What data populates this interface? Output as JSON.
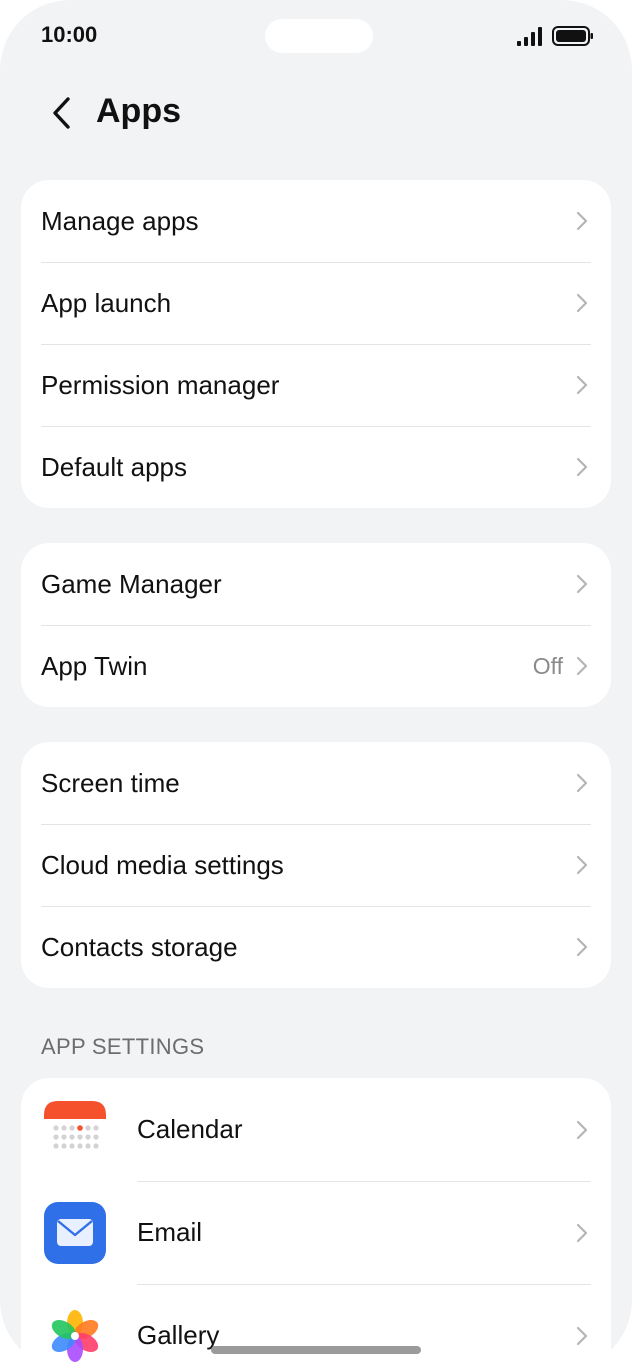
{
  "status_bar": {
    "time": "10:00",
    "icons": [
      "signal-icon",
      "battery-icon"
    ]
  },
  "header": {
    "title": "Apps",
    "back_icon": "chevron-left-icon"
  },
  "groups": [
    {
      "items": [
        {
          "label": "Manage apps"
        },
        {
          "label": "App launch"
        },
        {
          "label": "Permission manager"
        },
        {
          "label": "Default apps"
        }
      ]
    },
    {
      "items": [
        {
          "label": "Game Manager"
        },
        {
          "label": "App Twin",
          "value": "Off"
        }
      ]
    },
    {
      "items": [
        {
          "label": "Screen time"
        },
        {
          "label": "Cloud media settings"
        },
        {
          "label": "Contacts storage"
        }
      ]
    }
  ],
  "app_settings": {
    "section_label": "APP SETTINGS",
    "apps": [
      {
        "label": "Calendar",
        "icon": "calendar-icon"
      },
      {
        "label": "Email",
        "icon": "email-icon"
      },
      {
        "label": "Gallery",
        "icon": "gallery-icon"
      }
    ]
  },
  "colors": {
    "background": "#f2f3f5",
    "card": "#ffffff",
    "chevron": "#b5b5b5",
    "secondary_text": "#8a8a8a",
    "calendar_red": "#f4512c",
    "email_blue": "#2f6fe8"
  }
}
